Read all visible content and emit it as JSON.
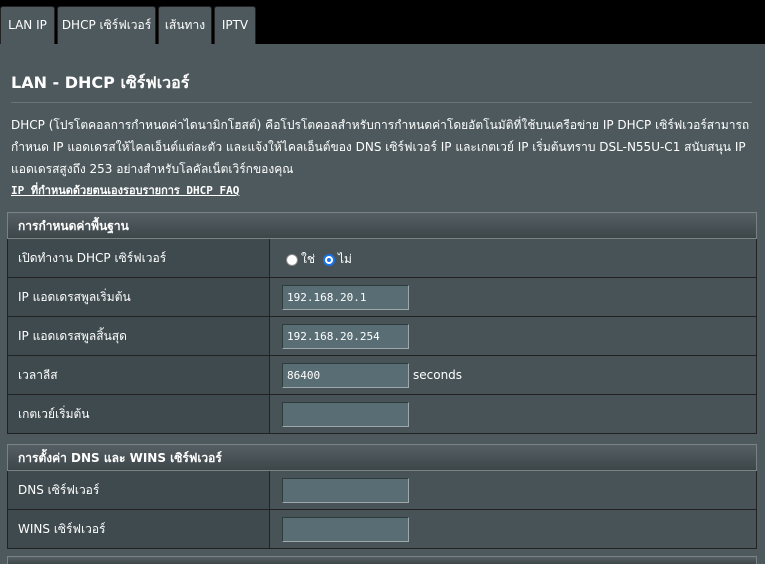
{
  "tabs": [
    {
      "label": "LAN IP"
    },
    {
      "label": "DHCP เซิร์ฟเวอร์"
    },
    {
      "label": "เส้นทาง"
    },
    {
      "label": "IPTV"
    }
  ],
  "page": {
    "title": "LAN - DHCP เซิร์ฟเวอร์",
    "description": "DHCP (โปรโตคอลการกำหนดค่าไดนามิกโฮสต์) คือโปรโตคอลสำหรับการกำหนดค่าโดยอัตโนมัติที่ใช้บนเครือข่าย IP DHCP เซิร์ฟเวอร์สามารถกำหนด IP แอดเดรสให้ไคลเอ็นต์แต่ละตัว และแจ้งให้ไคลเอ็นต์ของ DNS เซิร์ฟเวอร์ IP และเกตเวย์ IP เริ่มต้นทราบ DSL-N55U-C1 สนับสนุน IP แอดเดรสสูงถึง 253 อย่างสำหรับโลคัลเน็ตเวิร์กของคุณ",
    "faq_link": "IP ที่กำหนดด้วยตนเองรอบรายการ DHCP FAQ"
  },
  "basic": {
    "header": "การกำหนดค่าพื้นฐาน",
    "enable_label": "เปิดทำงาน DHCP เซิร์ฟเวอร์",
    "enable_yes": "ใช่",
    "enable_no": "ไม่",
    "enable_selected": "no",
    "pool_start_label": "IP แอดเดรสพูลเริ่มต้น",
    "pool_start_value": "192.168.20.1",
    "pool_end_label": "IP แอดเดรสพูลสิ้นสุด",
    "pool_end_value": "192.168.20.254",
    "lease_label": "เวลาลีส",
    "lease_value": "86400",
    "lease_unit": "seconds",
    "gateway_label": "เกตเวย์เริ่มต้น",
    "gateway_value": ""
  },
  "dns": {
    "header": "การตั้งค่า DNS และ WINS เซิร์ฟเวอร์",
    "dns_label": "DNS เซิร์ฟเวอร์",
    "dns_value": "",
    "wins_label": "WINS เซิร์ฟเวอร์",
    "wins_value": ""
  },
  "colors": {
    "panel": "#4d595d",
    "radio_checked": "#1a73e8"
  }
}
